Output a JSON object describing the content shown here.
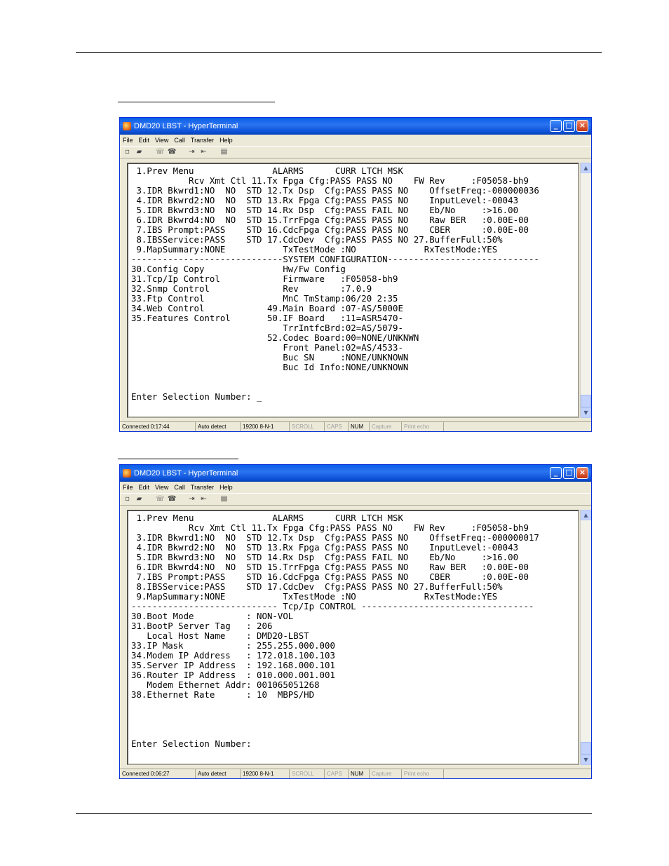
{
  "windows": [
    {
      "title": "DMD20 LBST - HyperTerminal",
      "menu": [
        "File",
        "Edit",
        "View",
        "Call",
        "Transfer",
        "Help"
      ],
      "toolbar_icons": [
        "new-icon",
        "open-icon",
        "disconnect-icon",
        "dial-icon",
        "send-icon",
        "receive-icon",
        "properties-icon"
      ],
      "terminal_lines": [
        " 1.Prev Menu               ALARMS      CURR LTCH MSK",
        "           Rcv Xmt Ctl 11.Tx Fpga Cfg:PASS PASS NO    FW Rev     :F05058-bh9",
        " 3.IDR Bkwrd1:NO  NO  STD 12.Tx Dsp  Cfg:PASS PASS NO    OffsetFreq:-000000036",
        " 4.IDR Bkwrd2:NO  NO  STD 13.Rx Fpga Cfg:PASS PASS NO    InputLevel:-00043",
        " 5.IDR Bkwrd3:NO  NO  STD 14.Rx Dsp  Cfg:PASS FAIL NO    Eb/No     :>16.00",
        " 6.IDR Bkwrd4:NO  NO  STD 15.TrrFpga Cfg:PASS PASS NO    Raw BER   :0.00E-00",
        " 7.IBS Prompt:PASS    STD 16.CdcFpga Cfg:PASS PASS NO    CBER      :0.00E-00",
        " 8.IBSService:PASS    STD 17.CdcDev  Cfg:PASS PASS NO 27.BufferFull:50%",
        " 9.MapSummary:NONE           TxTestMode :NO             RxTestMode:YES",
        "-----------------------------SYSTEM CONFIGURATION-----------------------------",
        "30.Config Copy               Hw/Fw Config",
        "31.Tcp/Ip Control            Firmware   :F05058-bh9",
        "32.Snmp Control              Rev        :7.0.9",
        "33.Ftp Control               MnC TmStamp:06/20 2:35",
        "34.Web Control            49.Main Board :07-AS/5000E",
        "35.Features Control       50.IF Board   :11=ASR5470-",
        "                             TrrIntfcBrd:02=AS/5079-",
        "                          52.Codec Board:00=NONE/UNKNWN",
        "                             Front Panel:02=AS/4533-",
        "                             Buc SN     :NONE/UNKNOWN",
        "                             Buc Id Info:NONE/UNKNOWN",
        "",
        "",
        "Enter Selection Number: _"
      ],
      "status": [
        "Connected 0:17:44",
        "Auto detect",
        "19200 8-N-1",
        "SCROLL",
        "CAPS",
        "NUM",
        "Capture",
        "Print echo"
      ]
    },
    {
      "title": "DMD20 LBST - HyperTerminal",
      "menu": [
        "File",
        "Edit",
        "View",
        "Call",
        "Transfer",
        "Help"
      ],
      "toolbar_icons": [
        "new-icon",
        "open-icon",
        "disconnect-icon",
        "dial-icon",
        "send-icon",
        "receive-icon",
        "properties-icon"
      ],
      "terminal_lines": [
        " 1.Prev Menu               ALARMS      CURR LTCH MSK",
        "           Rcv Xmt Ctl 11.Tx Fpga Cfg:PASS PASS NO    FW Rev     :F05058-bh9",
        " 3.IDR Bkwrd1:NO  NO  STD 12.Tx Dsp  Cfg:PASS PASS NO    OffsetFreq:-000000017",
        " 4.IDR Bkwrd2:NO  NO  STD 13.Rx Fpga Cfg:PASS PASS NO    InputLevel:-00043",
        " 5.IDR Bkwrd3:NO  NO  STD 14.Rx Dsp  Cfg:PASS FAIL NO    Eb/No     :>16.00",
        " 6.IDR Bkwrd4:NO  NO  STD 15.TrrFpga Cfg:PASS PASS NO    Raw BER   :0.00E-00",
        " 7.IBS Prompt:PASS    STD 16.CdcFpga Cfg:PASS PASS NO    CBER      :0.00E-00",
        " 8.IBSService:PASS    STD 17.CdcDev  Cfg:PASS PASS NO 27.BufferFull:50%",
        " 9.MapSummary:NONE           TxTestMode :NO             RxTestMode:YES",
        "---------------------------- Tcp/Ip CONTROL ---------------------------------",
        "30.Boot Mode          : NON-VOL",
        "31.BootP Server Tag   : 206",
        "   Local Host Name    : DMD20-LBST",
        "33.IP Mask            : 255.255.000.000",
        "34.Modem IP Address   : 172.018.100.103",
        "35.Server IP Address  : 192.168.000.101",
        "36.Router IP Address  : 010.000.001.001",
        "   Modem Ethernet Addr: 001065051268",
        "38.Ethernet Rate      : 10  MBPS/HD",
        "",
        "",
        "",
        "",
        "Enter Selection Number:"
      ],
      "status": [
        "Connected 0:06:27",
        "Auto detect",
        "19200 8-N-1",
        "SCROLL",
        "CAPS",
        "NUM",
        "Capture",
        "Print echo"
      ]
    }
  ]
}
